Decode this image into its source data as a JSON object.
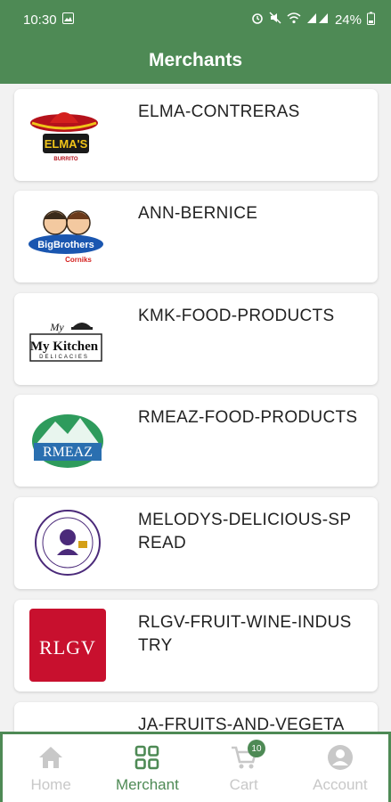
{
  "status_bar": {
    "time": "10:30",
    "battery": "24%",
    "icons": [
      "image-icon",
      "alarm-icon",
      "mute-icon",
      "wifi-icon",
      "signal-icon",
      "battery-icon"
    ]
  },
  "header": {
    "title": "Merchants"
  },
  "merchants": [
    {
      "name": "ELMA-CONTRERAS",
      "logo_text": "ELMA'S"
    },
    {
      "name": "ANN-BERNICE",
      "logo_text": "BigBrothers"
    },
    {
      "name": "KMK-FOOD-PRODUCTS",
      "logo_text": "My Kitchen"
    },
    {
      "name": "RMEAZ-FOOD-PRODUCTS",
      "logo_text": "RMEAZ"
    },
    {
      "name": "MELODYS-DELICIOUS-SPREAD",
      "logo_text": ""
    },
    {
      "name": "RLGV-FRUIT-WINE-INDUSTRY",
      "logo_text": "RLGV"
    },
    {
      "name": "JA-FRUITS-AND-VEGETA",
      "logo_text": ""
    }
  ],
  "bottom_nav": [
    {
      "label": "Home",
      "icon": "home-icon",
      "active": false
    },
    {
      "label": "Merchant",
      "icon": "grid-icon",
      "active": true
    },
    {
      "label": "Cart",
      "icon": "cart-icon",
      "active": false,
      "badge": "10"
    },
    {
      "label": "Account",
      "icon": "account-icon",
      "active": false
    }
  ],
  "colors": {
    "primary": "#4e8a55",
    "inactive": "#c8c8c8",
    "rlgv_red": "#c8102e"
  }
}
